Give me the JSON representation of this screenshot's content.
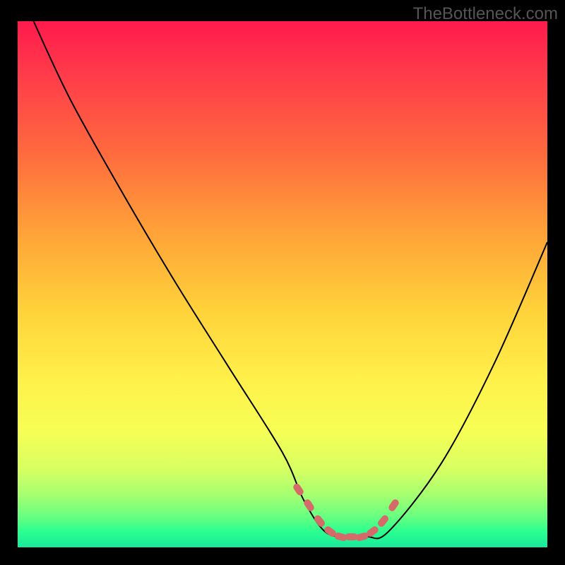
{
  "attribution": "TheBottleneck.com",
  "chart_data": {
    "type": "line",
    "title": "",
    "xlabel": "",
    "ylabel": "",
    "xlim": [
      0,
      100
    ],
    "ylim": [
      0,
      100
    ],
    "series": [
      {
        "name": "bottleneck-curve",
        "x": [
          3,
          10,
          20,
          30,
          40,
          50,
          54,
          58,
          62,
          66,
          70,
          80,
          90,
          100
        ],
        "values": [
          100,
          85,
          67,
          50,
          34,
          18,
          9,
          3,
          2,
          2,
          3,
          16,
          35,
          58
        ]
      }
    ],
    "markers": {
      "name": "optimal-range",
      "color": "#d46a6a",
      "x": [
        53,
        55,
        57,
        59,
        61,
        63,
        65,
        67,
        69,
        71
      ],
      "values": [
        11,
        8,
        5,
        3,
        2,
        2,
        2,
        3,
        5,
        8
      ]
    },
    "colors": {
      "background_top": "#ff1a4d",
      "background_bottom": "#18e89a",
      "curve": "#000000",
      "marker": "#d46a6a"
    }
  }
}
